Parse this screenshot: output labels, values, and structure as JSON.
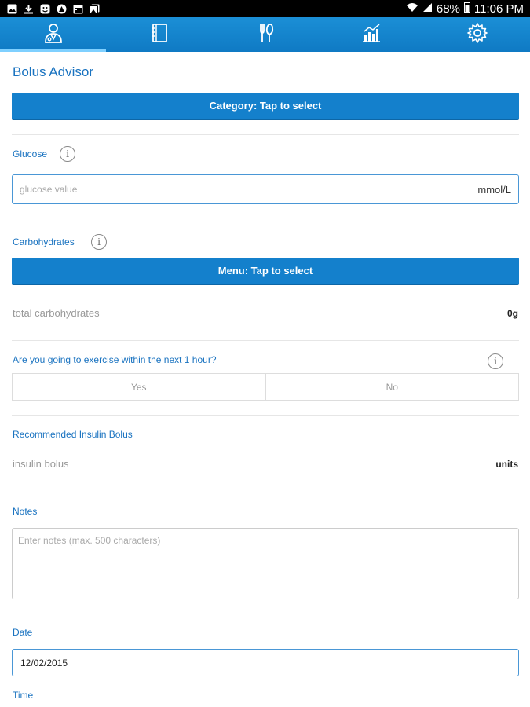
{
  "status_bar": {
    "battery": "68%",
    "time": "11:06 PM",
    "left_icons": [
      "image-icon",
      "download-icon",
      "face-icon",
      "user-circle-icon",
      "calendar-icon",
      "gallery-icon"
    ]
  },
  "nav": {
    "tabs": [
      {
        "name": "advisor",
        "icon": "doctor-icon",
        "active": true
      },
      {
        "name": "logbook",
        "icon": "notebook-icon",
        "active": false
      },
      {
        "name": "meals",
        "icon": "fork-knife-icon",
        "active": false
      },
      {
        "name": "reports",
        "icon": "chart-icon",
        "active": false
      },
      {
        "name": "settings",
        "icon": "gear-icon",
        "active": false
      }
    ]
  },
  "page": {
    "title": "Bolus Advisor",
    "category_button": "Category: Tap to select"
  },
  "glucose": {
    "label": "Glucose",
    "placeholder": "glucose value",
    "unit": "mmol/L"
  },
  "carbs": {
    "label": "Carbohydrates",
    "menu_button": "Menu: Tap to select",
    "total_label": "total carbohydrates",
    "total_value": "0g"
  },
  "exercise": {
    "question": "Are you going to exercise within the next 1 hour?",
    "yes": "Yes",
    "no": "No"
  },
  "recommended": {
    "label": "Recommended Insulin Bolus",
    "bolus_label": "insulin bolus",
    "bolus_unit": "units"
  },
  "notes": {
    "label": "Notes",
    "placeholder": "Enter notes (max. 500 characters)"
  },
  "date": {
    "label": "Date",
    "value": "12/02/2015"
  },
  "time": {
    "label": "Time"
  },
  "colors": {
    "accent": "#1480cc",
    "label_blue": "#1a73c0"
  }
}
